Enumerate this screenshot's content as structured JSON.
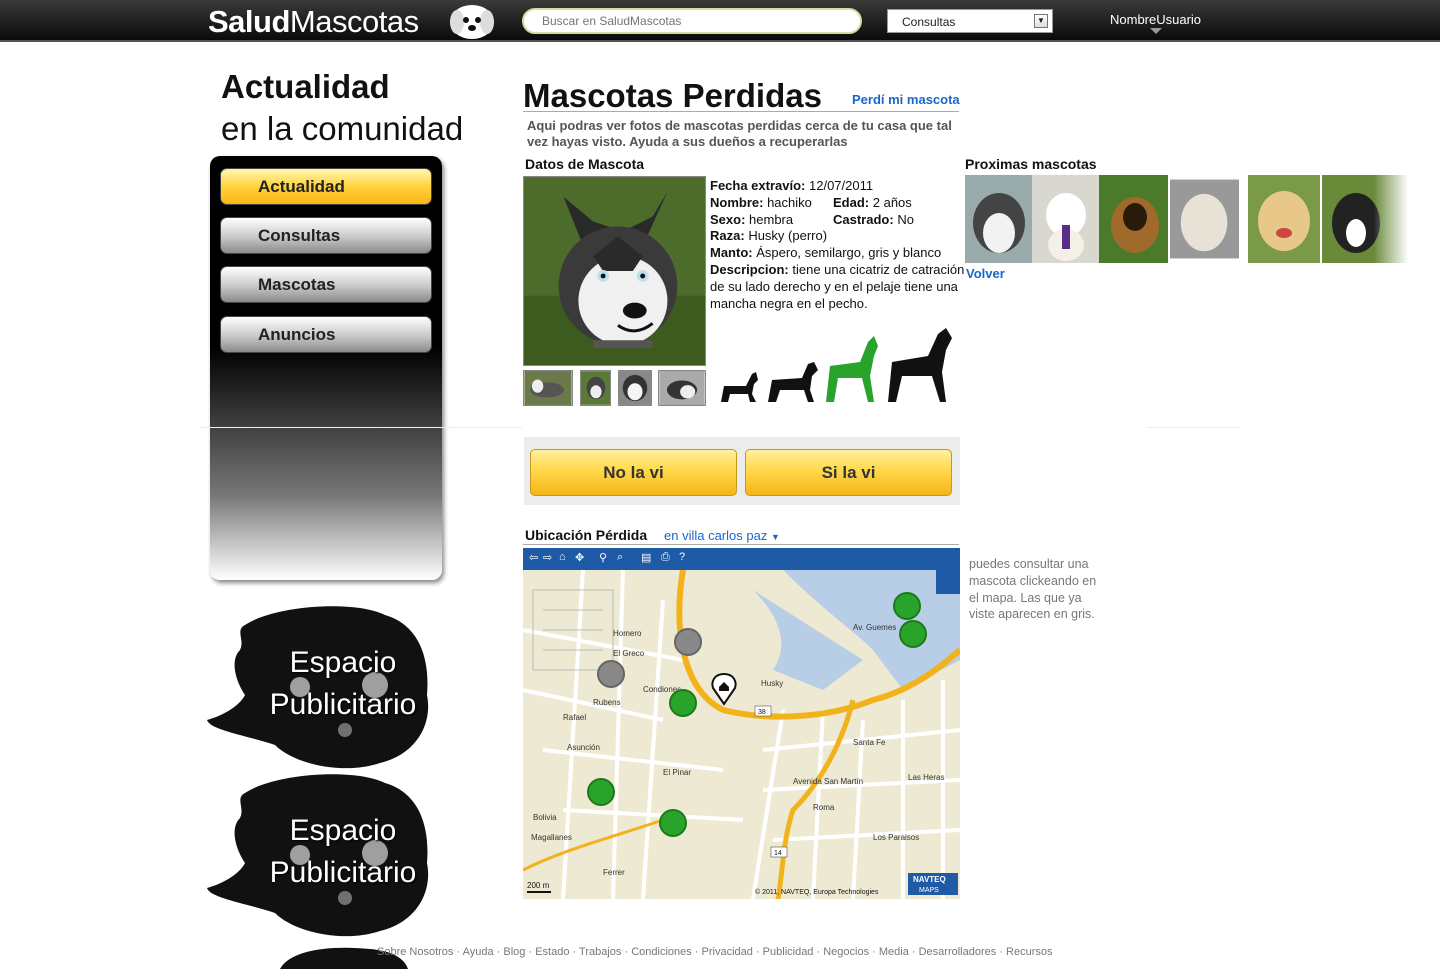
{
  "header": {
    "logo_bold": "Salud",
    "logo_regular": "Mascotas",
    "search_placeholder": "Buscar en SaludMascotas",
    "select_value": "Consultas",
    "username": "NombreUsuario"
  },
  "sidebar": {
    "heading_line1": "Actualidad",
    "heading_line2": "en la comunidad",
    "menu": [
      {
        "label": "Actualidad",
        "active": true
      },
      {
        "label": "Consultas",
        "active": false
      },
      {
        "label": "Mascotas",
        "active": false
      },
      {
        "label": "Anuncios",
        "active": false
      }
    ],
    "ads": [
      {
        "line1": "Espacio",
        "line2": "Publicitario"
      },
      {
        "line1": "Espacio",
        "line2": "Publicitario"
      }
    ]
  },
  "main": {
    "title": "Mascotas Perdidas",
    "lost_link": "Perdí mi mascota",
    "intro": "Aqui podras ver fotos de mascotas perdidas cerca de tu casa que tal vez hayas visto. Ayuda a sus dueños a recuperarlas",
    "pet_section_title": "Datos de Mascota",
    "pet": {
      "date_label": "Fecha extravío:",
      "date_value": "12/07/2011",
      "name_label": "Nombre:",
      "name_value": "hachiko",
      "age_label": "Edad:",
      "age_value": "2 años",
      "sex_label": "Sexo:",
      "sex_value": "hembra",
      "neutered_label": "Castrado:",
      "neutered_value": "No",
      "breed_label": "Raza:",
      "breed_value": "Husky (perro)",
      "coat_label": "Manto:",
      "coat_value": "Áspero, semilargo, gris y blanco",
      "desc_label": "Descripcion:",
      "desc_value": "tiene una cicatriz de catración de su lado derecho y en el pelaje tiene una mancha negra en el pecho."
    },
    "size_icons": [
      {
        "icon": "small-dog-silhouette-icon",
        "color": "#111111"
      },
      {
        "icon": "medium-dog-silhouette-icon",
        "color": "#111111"
      },
      {
        "icon": "large-dog-silhouette-icon",
        "color": "#2aa32a"
      },
      {
        "icon": "xlarge-dog-silhouette-icon",
        "color": "#111111"
      }
    ],
    "btn_no": "No la vi",
    "btn_yes": "Si la vi",
    "location_title": "Ubicación Pérdida",
    "location_link": "en villa carlos paz",
    "map_note": "puedes consultar una mascota clickeando en el mapa. Las que ya viste aparecen en gris.",
    "map_scale": "200 m",
    "map_copyright": "© 2011, NAVTEQ, Europa Technologies",
    "map_brand_line1": "NAVTEQ",
    "map_brand_line2": "MAPS",
    "map_streets": [
      "Asunción",
      "Homero",
      "El Greco",
      "Rubens",
      "Rafael",
      "Condiones",
      "Husky",
      "Avenida San Martín",
      "38",
      "14",
      "Las Heras",
      "Santa Fe",
      "Av. Guemes",
      "Roma",
      "Los Paraisos",
      "Bolivia",
      "Magallanes",
      "El Pinar",
      "Ferrer"
    ]
  },
  "next": {
    "title": "Proximas mascotas",
    "back_link": "Volver"
  },
  "footer": {
    "links": [
      "Sobre Nosotros",
      "Ayuda",
      "Blog",
      "Estado",
      "Trabajos",
      "Condiciones",
      "Privacidad",
      "Publicidad",
      "Negocios",
      "Media",
      "Desarrolladores",
      "Recursos"
    ]
  },
  "colors": {
    "accent_link": "#1a66cc",
    "button_yellow": "#ffd94a",
    "map_marker_green": "#2aa32a",
    "map_marker_gray": "#888888"
  }
}
